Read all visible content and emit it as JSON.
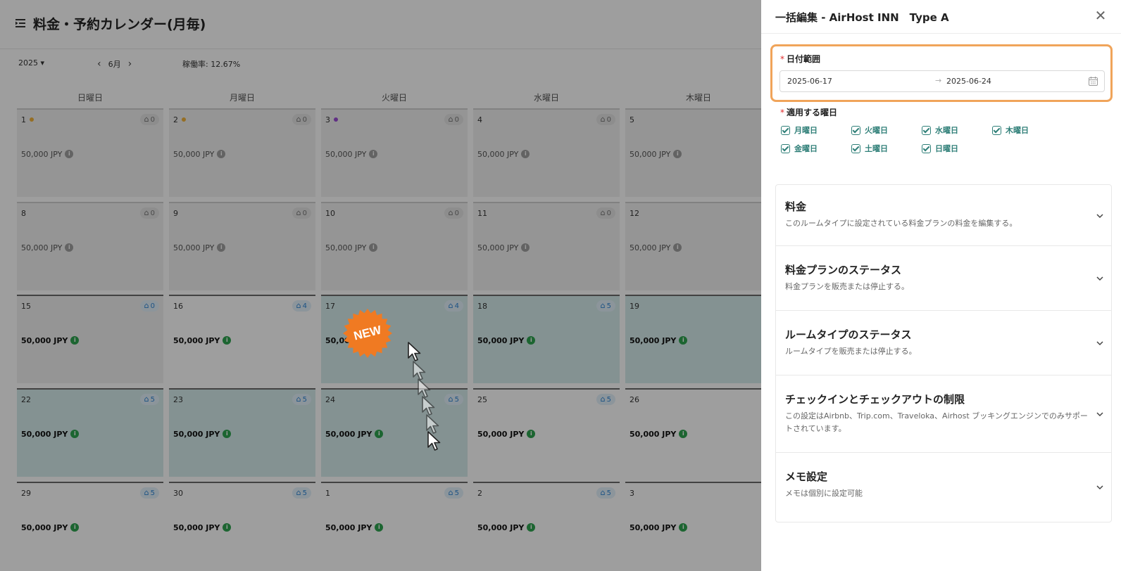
{
  "page": {
    "title": "料金・予約カレンダー(月毎)",
    "year": "2025 ▾",
    "month": "6月",
    "prev_arrow": "‹",
    "next_arrow": "›",
    "occupancy": "稼働率: 12.67%"
  },
  "weekdays": [
    "日曜日",
    "月曜日",
    "火曜日",
    "水曜日",
    "木曜日"
  ],
  "calendar": {
    "rows": [
      [
        {
          "day": "1",
          "dot": "#f0b23a",
          "inv": "0",
          "price": "50,000 JPY",
          "state": "past"
        },
        {
          "day": "2",
          "dot": "#f0b23a",
          "inv": "0",
          "price": "50,000 JPY",
          "state": "past"
        },
        {
          "day": "3",
          "dot": "#9b4dd6",
          "inv": "0",
          "price": "50,000 JPY",
          "state": "past"
        },
        {
          "day": "4",
          "dot": "",
          "inv": "0",
          "price": "50,000 JPY",
          "state": "past"
        },
        {
          "day": "5",
          "dot": "",
          "inv": "",
          "price": "50,000 JPY",
          "state": "past"
        }
      ],
      [
        {
          "day": "8",
          "dot": "",
          "inv": "0",
          "price": "50,000 JPY",
          "state": "past"
        },
        {
          "day": "9",
          "dot": "",
          "inv": "0",
          "price": "50,000 JPY",
          "state": "past"
        },
        {
          "day": "10",
          "dot": "",
          "inv": "0",
          "price": "50,000 JPY",
          "state": "past"
        },
        {
          "day": "11",
          "dot": "",
          "inv": "0",
          "price": "50,000 JPY",
          "state": "past"
        },
        {
          "day": "12",
          "dot": "",
          "inv": "",
          "price": "50,000 JPY",
          "state": "past"
        }
      ],
      [
        {
          "day": "15",
          "dot": "",
          "inv": "0",
          "price": "50,000 JPY",
          "state": "today"
        },
        {
          "day": "16",
          "dot": "",
          "inv": "4",
          "price": "50,000 JPY",
          "state": "normal"
        },
        {
          "day": "17",
          "dot": "",
          "inv": "4",
          "price": "50,000 JPY",
          "state": "selected"
        },
        {
          "day": "18",
          "dot": "",
          "inv": "5",
          "price": "50,000 JPY",
          "state": "selected"
        },
        {
          "day": "19",
          "dot": "",
          "inv": "",
          "price": "50,000 JPY",
          "state": "selected"
        }
      ],
      [
        {
          "day": "22",
          "dot": "",
          "inv": "5",
          "price": "50,000 JPY",
          "state": "selected"
        },
        {
          "day": "23",
          "dot": "",
          "inv": "5",
          "price": "50,000 JPY",
          "state": "selected"
        },
        {
          "day": "24",
          "dot": "",
          "inv": "5",
          "price": "50,000 JPY",
          "state": "selected"
        },
        {
          "day": "25",
          "dot": "",
          "inv": "5",
          "price": "50,000 JPY",
          "state": "normal"
        },
        {
          "day": "26",
          "dot": "",
          "inv": "",
          "price": "50,000 JPY",
          "state": "normal"
        }
      ],
      [
        {
          "day": "29",
          "dot": "",
          "inv": "5",
          "price": "50,000 JPY",
          "state": "normal"
        },
        {
          "day": "30",
          "dot": "",
          "inv": "5",
          "price": "50,000 JPY",
          "state": "normal"
        },
        {
          "day": "1",
          "dot": "",
          "inv": "5",
          "price": "50,000 JPY",
          "state": "normal"
        },
        {
          "day": "2",
          "dot": "",
          "inv": "5",
          "price": "50,000 JPY",
          "state": "normal"
        },
        {
          "day": "3",
          "dot": "",
          "inv": "",
          "price": "50,000 JPY",
          "state": "normal"
        }
      ]
    ]
  },
  "badge": {
    "label": "NEW",
    "color": "#f07a22"
  },
  "drawer": {
    "title": "一括編集 - AirHost INN　Type A",
    "close": "✕",
    "date_range_label": "日付範囲",
    "required_mark": "*",
    "date_start": "2025-06-17",
    "date_sep": "→",
    "date_end": "2025-06-24",
    "weekdays_label": "適用する曜日",
    "weekdays": [
      {
        "label": "月曜日",
        "checked": true
      },
      {
        "label": "火曜日",
        "checked": true
      },
      {
        "label": "水曜日",
        "checked": true
      },
      {
        "label": "木曜日",
        "checked": true
      },
      {
        "label": "金曜日",
        "checked": true
      },
      {
        "label": "土曜日",
        "checked": true
      },
      {
        "label": "日曜日",
        "checked": true
      }
    ],
    "sections": [
      {
        "title": "料金",
        "desc": "このルームタイプに設定されている料金プランの料金を編集する。"
      },
      {
        "title": "料金プランのステータス",
        "desc": "料金プランを販売または停止する。"
      },
      {
        "title": "ルームタイプのステータス",
        "desc": "ルームタイプを販売または停止する。"
      },
      {
        "title": "チェックインとチェックアウトの制限",
        "desc": "この設定はAirbnb、Trip.com、Traveloka、Airhost ブッキングエンジンでのみサポートされています。"
      },
      {
        "title": "メモ設定",
        "desc": "メモは個別に設定可能"
      }
    ]
  }
}
